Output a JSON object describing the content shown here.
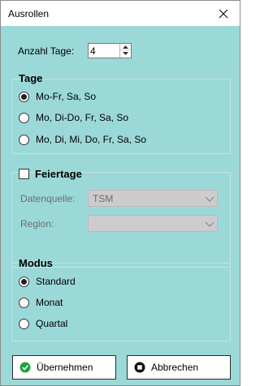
{
  "colors": {
    "client_bg": "#9bd9d8",
    "ok_icon": "#22a33a",
    "cancel_icon": "#111111"
  },
  "window": {
    "title": "Ausrollen",
    "close_icon": "close-icon"
  },
  "days": {
    "label": "Anzahl Tage:",
    "value": "4"
  },
  "tage": {
    "title": "Tage",
    "options": [
      {
        "label": "Mo-Fr, Sa, So",
        "checked": true
      },
      {
        "label": "Mo, Di-Do, Fr, Sa, So",
        "checked": false
      },
      {
        "label": "Mo, Di, Mi, Do, Fr, Sa, So",
        "checked": false
      }
    ]
  },
  "feiertage": {
    "title": "Feiertage",
    "checked": false,
    "datenquelle_label": "Datenquelle:",
    "datenquelle_value": "TSM",
    "region_label": "Region:",
    "region_value": ""
  },
  "modus": {
    "title": "Modus",
    "options": [
      {
        "label": "Standard",
        "checked": true
      },
      {
        "label": "Monat",
        "checked": false
      },
      {
        "label": "Quartal",
        "checked": false
      }
    ]
  },
  "buttons": {
    "ok_label": "Übernehmen",
    "cancel_label": "Abbrechen"
  }
}
